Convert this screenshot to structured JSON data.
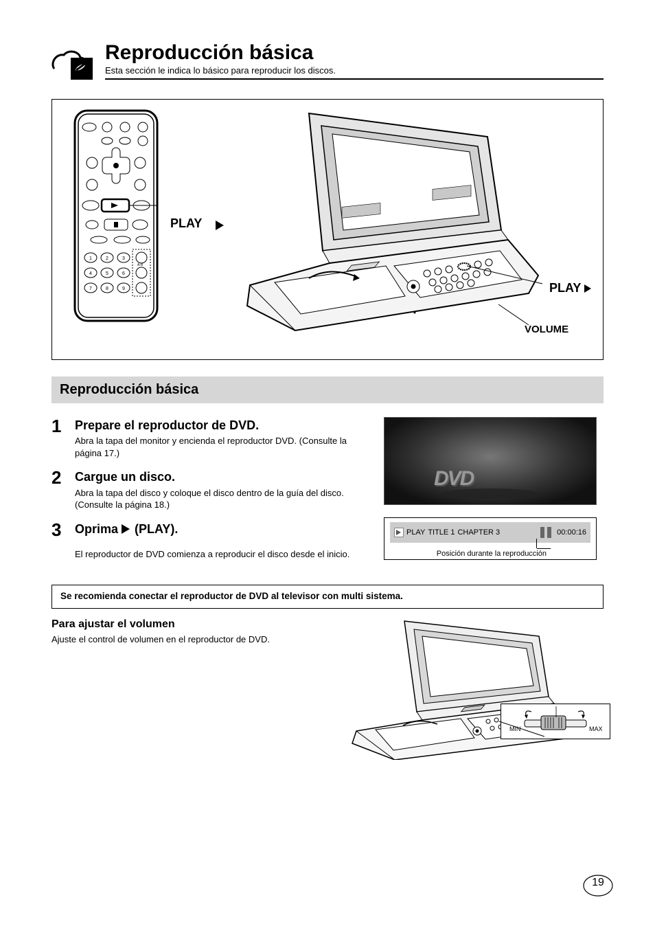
{
  "header": {
    "title": "Reproducción básica",
    "subtitle": "Esta sección le indica lo básico para reproducir los discos."
  },
  "labels": {
    "play": "PLAY",
    "volume": "VOLUME"
  },
  "section_title": "Reproducción básica",
  "steps": [
    {
      "num": "1",
      "head": "Prepare el reproductor de DVD.",
      "sub": "Abra la tapa del monitor y encienda el reproductor DVD. (Consulte la página 17.)"
    },
    {
      "num": "2",
      "head": "Cargue un disco.",
      "sub": "Abra la tapa del disco y coloque el disco dentro de la guía del disco. (Consulte la página 18.)"
    },
    {
      "num": "3",
      "head": "Oprima      (PLAY)."
    }
  ],
  "after_step": "El reproductor de DVD comienza a reproducir el disco desde el inicio.",
  "osd": {
    "play": "PLAY",
    "title": "TITLE 1",
    "chapter": "CHAPTER 3",
    "time": "00:00:16",
    "caption": "Posición durante la reproducción"
  },
  "note_box": "Se recomienda conectar el reproductor de DVD al televisor con multi sistema.",
  "volume_section": {
    "title": "Para ajustar el volumen",
    "body": "Ajuste el control de volumen en el reproductor de DVD."
  },
  "volume_inset": {
    "min": "MIN",
    "max": "MAX"
  },
  "page": "19"
}
